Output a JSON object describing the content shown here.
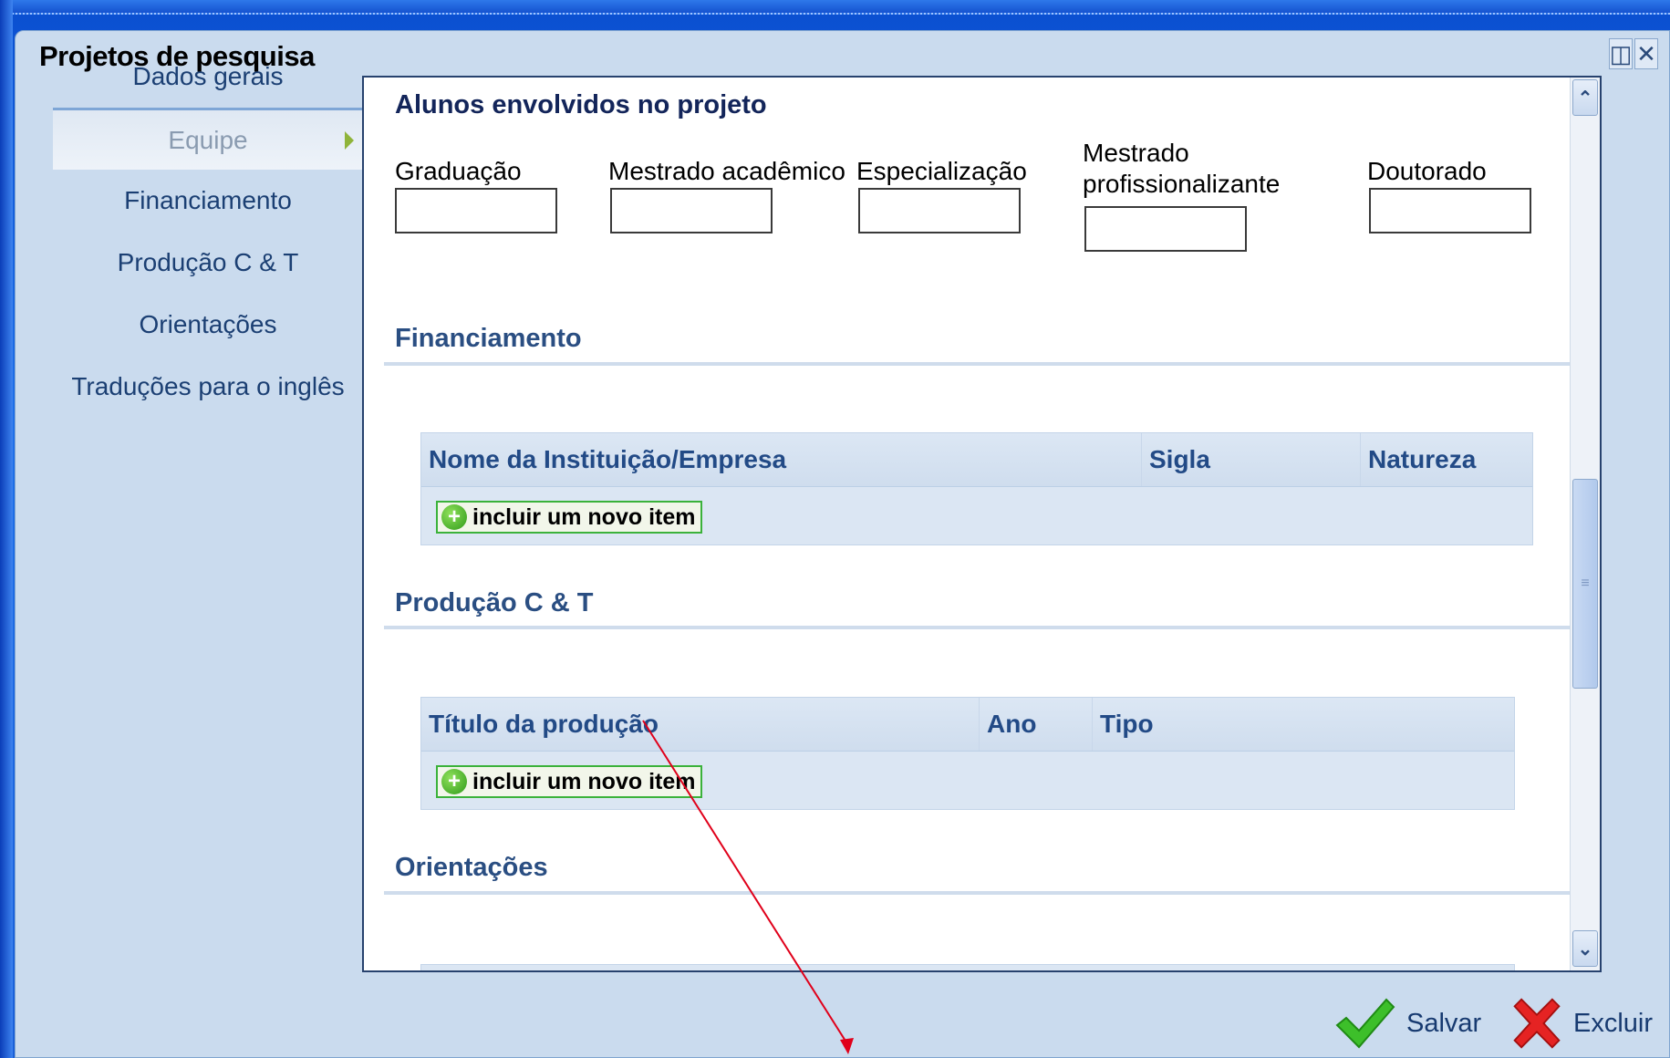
{
  "window": {
    "title": "Projetos de pesquisa"
  },
  "sidebar": {
    "items": [
      {
        "label": "Dados gerais"
      },
      {
        "label": "Equipe"
      },
      {
        "label": "Financiamento"
      },
      {
        "label": "Produção C & T"
      },
      {
        "label": "Orientações"
      },
      {
        "label": "Traduções para o inglês"
      }
    ],
    "active_index": 1
  },
  "students": {
    "title": "Alunos envolvidos no projeto",
    "fields": [
      {
        "label": "Graduação",
        "value": ""
      },
      {
        "label": "Mestrado acadêmico",
        "value": ""
      },
      {
        "label": "Especialização",
        "value": ""
      },
      {
        "label_line1": "Mestrado",
        "label_line2": "profissionalizante",
        "value": ""
      },
      {
        "label": "Doutorado",
        "value": ""
      }
    ]
  },
  "financiamento": {
    "title": "Financiamento",
    "columns": [
      "Nome da Instituição/Empresa",
      "Sigla",
      "Natureza"
    ],
    "add_label": "incluir um novo item"
  },
  "producao": {
    "title": "Produção C & T",
    "columns": [
      "Título da produção",
      "Ano",
      "Tipo"
    ],
    "add_label": "incluir um novo item"
  },
  "orientacoes": {
    "title": "Orientações"
  },
  "footer": {
    "save_label": "Salvar",
    "delete_label": "Excluir"
  },
  "colors": {
    "section_title": "#2a4e82",
    "annotation_line": "#e0001a",
    "add_border": "#3bb23b"
  }
}
